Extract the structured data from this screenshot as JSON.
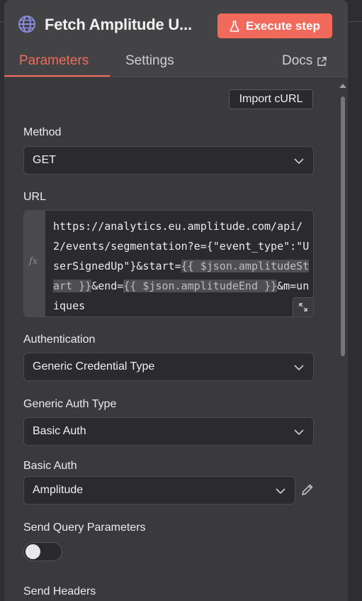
{
  "node": {
    "title": "Fetch Amplitude U...",
    "execute_label": "Execute step"
  },
  "tabs": {
    "parameters": "Parameters",
    "settings": "Settings",
    "docs": "Docs"
  },
  "import_curl_label": "Import cURL",
  "method": {
    "label": "Method",
    "value": "GET"
  },
  "url": {
    "label": "URL",
    "fx_label": "fx",
    "parts": [
      {
        "text": "https://analytics.eu.amplitude.com/api/2/events/segmentation?e={\"event_type\":\"UserSignedUp\"}&start=",
        "expr": false
      },
      {
        "text": "{{ $json.amplitudeStart }}",
        "expr": true
      },
      {
        "text": "&end=",
        "expr": false
      },
      {
        "text": "{{ $json.amplitudeEnd }}",
        "expr": true
      },
      {
        "text": "&m=uniques",
        "expr": false
      }
    ]
  },
  "authentication": {
    "label": "Authentication",
    "value": "Generic Credential Type"
  },
  "generic_auth_type": {
    "label": "Generic Auth Type",
    "value": "Basic Auth"
  },
  "basic_auth": {
    "label": "Basic Auth",
    "value": "Amplitude"
  },
  "send_query_parameters": {
    "label": "Send Query Parameters",
    "enabled": false
  },
  "send_headers": {
    "label": "Send Headers"
  },
  "colors": {
    "accent": "#f26a5b",
    "panel_bg": "#434345",
    "content_bg": "#3a3a3c",
    "input_bg": "#2b2b2d",
    "expression_bg": "#4f4f52"
  }
}
